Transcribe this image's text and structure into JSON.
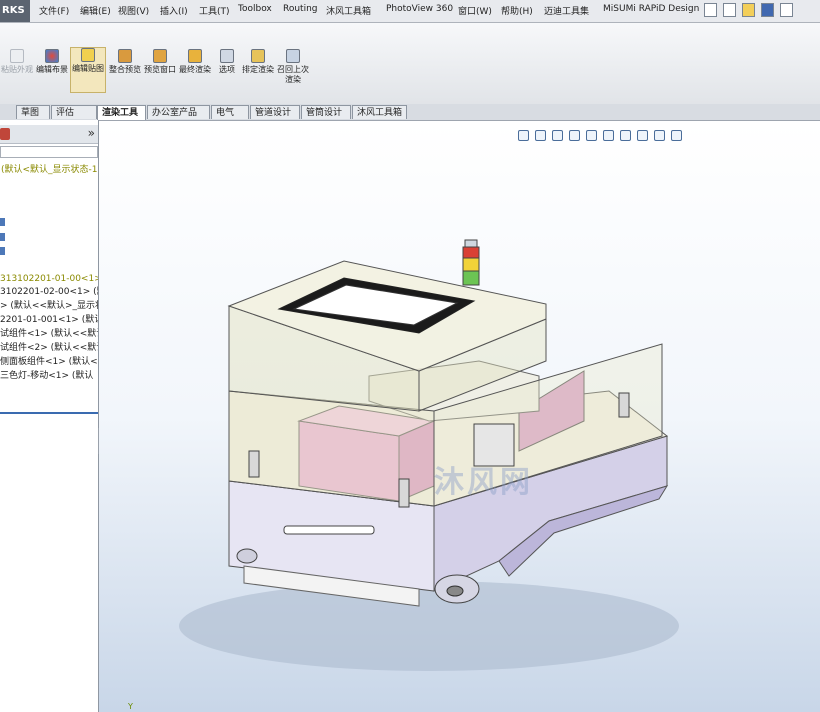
{
  "app": {
    "brand_fragment": "RKS"
  },
  "menu": [
    {
      "label": "文件(F)"
    },
    {
      "label": "编辑(E)"
    },
    {
      "label": "视图(V)"
    },
    {
      "label": "插入(I)"
    },
    {
      "label": "工具(T)"
    },
    {
      "label": "Toolbox"
    },
    {
      "label": "Routing"
    },
    {
      "label": "沐风工具箱"
    },
    {
      "label": "PhotoView 360"
    },
    {
      "label": "窗口(W)"
    },
    {
      "label": "帮助(H)"
    },
    {
      "label": "迈迪工具集"
    },
    {
      "label": "MiSUMi RAPiD Design"
    }
  ],
  "toolbar": {
    "buttons": [
      {
        "label": "粘贴外观",
        "icon": "paste-appearance-icon",
        "state": "disabled"
      },
      {
        "label": "编辑布景",
        "icon": "edit-scene-icon",
        "state": "normal"
      },
      {
        "label": "编辑贴图",
        "icon": "edit-decal-icon",
        "state": "active"
      },
      {
        "label": "整合预览",
        "icon": "integrated-preview-icon",
        "state": "normal"
      },
      {
        "label": "预览窗口",
        "icon": "preview-window-icon",
        "state": "normal"
      },
      {
        "label": "最终渲染",
        "icon": "final-render-icon",
        "state": "normal"
      },
      {
        "label": "选项",
        "icon": "options-icon",
        "state": "normal"
      },
      {
        "label": "排定渲染",
        "icon": "schedule-render-icon",
        "state": "normal"
      },
      {
        "label": "召回上次渲染",
        "icon": "recall-last-render-icon",
        "state": "normal"
      }
    ]
  },
  "tabs": [
    {
      "label": "草图",
      "active": false
    },
    {
      "label": "评估",
      "active": false
    },
    {
      "label": "渲染工具",
      "active": true
    },
    {
      "label": "办公室产品",
      "active": false
    },
    {
      "label": "电气",
      "active": false
    },
    {
      "label": "管道设计",
      "active": false
    },
    {
      "label": "管筒设计",
      "active": false
    },
    {
      "label": "沐风工具箱",
      "active": false
    }
  ],
  "sidebar": {
    "more_glyph": "»",
    "root_config": "(默认<默认_显示状态-1",
    "tree": [
      {
        "text": "313102201-01-00<1>",
        "selected": true
      },
      {
        "text": "3102201-02-00<1> (默",
        "selected": false
      },
      {
        "text": "> (默认<<默认>_显示状",
        "selected": false
      },
      {
        "text": "2201-01-001<1> (默认",
        "selected": false
      },
      {
        "text": "试组件<1> (默认<<默认",
        "selected": false
      },
      {
        "text": "试组件<2> (默认<<默认",
        "selected": false
      },
      {
        "text": "侧面板组件<1> (默认<默",
        "selected": false
      },
      {
        "text": "三色灯-移动<1> (默认",
        "selected": false
      }
    ]
  },
  "viewport": {
    "watermark": "沐风网",
    "triad_label": "Y",
    "hud_icons": [
      "zoom-to-fit-icon",
      "zoom-area-icon",
      "previous-view-icon",
      "section-view-icon",
      "view-orientation-icon",
      "display-style-icon",
      "hide-show-items-icon",
      "edit-appearance-icon",
      "apply-scene-icon",
      "view-settings-icon"
    ]
  },
  "colors": {
    "title_bar": "#e8eaee",
    "active_tab": "#ffffff",
    "selected_tree_text": "#8a8a00",
    "viewport_bottom": "#c8d6e8",
    "enclosure_fill": "#e8e7c8",
    "pink_box": "#e6a5d6",
    "chassis": "#d8d4ea"
  }
}
